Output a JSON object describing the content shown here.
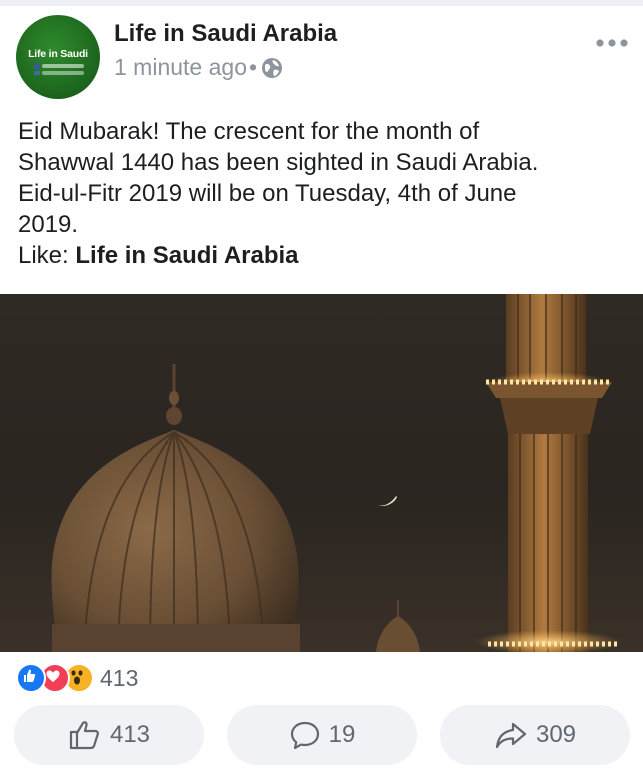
{
  "post": {
    "page_name": "Life in Saudi Arabia",
    "time": "1 minute ago",
    "separator": "•",
    "privacy_icon": "globe-icon",
    "avatar": {
      "text": "Life in Saudi",
      "color": "#1e6a1f"
    },
    "text_lines": [
      "Eid Mubarak! The crescent for the month of",
      "Shawwal 1440 has been sighted in Saudi Arabia.",
      "Eid-ul-Fitr 2019 will be on Tuesday, 4th of June",
      "2019."
    ],
    "like_prefix": "Like: ",
    "like_page": "Life in Saudi Arabia"
  },
  "reactions": {
    "icons": [
      "like-reaction-icon",
      "love-reaction-icon",
      "wow-reaction-icon"
    ],
    "total": "413"
  },
  "actions": {
    "like_count": "413",
    "comment_count": "19",
    "share_count": "309"
  },
  "colors": {
    "like_blue": "#1877f2",
    "love_red": "#f33e58",
    "wow_yellow": "#f7b125",
    "button_bg": "#f0f2f5",
    "muted_text": "#8d949e"
  }
}
